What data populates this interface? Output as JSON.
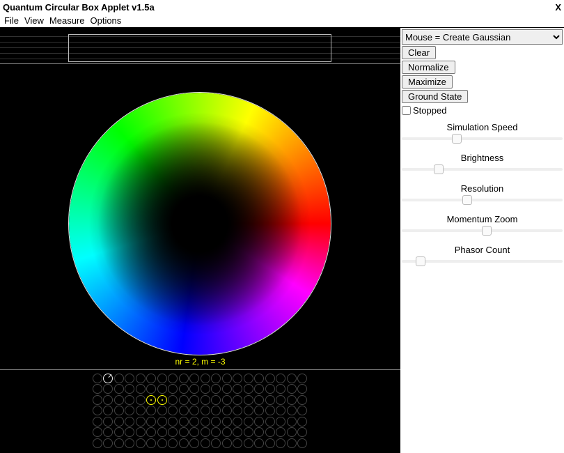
{
  "title": "Quantum Circular Box Applet v1.5a",
  "close_label": "X",
  "menu": [
    "File",
    "View",
    "Measure",
    "Options"
  ],
  "nr_label": "nr = 2, m = -3",
  "mouse_select": {
    "selected": "Mouse = Create Gaussian",
    "options": [
      "Mouse = Create Gaussian"
    ]
  },
  "buttons": {
    "clear": "Clear",
    "normalize": "Normalize",
    "maximize": "Maximize",
    "ground_state": "Ground State"
  },
  "stopped": {
    "label": "Stopped",
    "checked": false
  },
  "sliders": {
    "sim_speed": {
      "label": "Simulation Speed",
      "value": 33
    },
    "brightness": {
      "label": "Brightness",
      "value": 21
    },
    "resolution": {
      "label": "Resolution",
      "value": 40
    },
    "momentum_zoom": {
      "label": "Momentum Zoom",
      "value": 53
    },
    "phasor_count": {
      "label": "Phasor Count",
      "value": 9
    }
  },
  "phasor_grid": {
    "rows": 7,
    "cols": 20,
    "white_cell": {
      "row": 0,
      "col": 1
    },
    "active_cells": [
      {
        "row": 2,
        "col": 5
      },
      {
        "row": 2,
        "col": 6
      }
    ]
  }
}
